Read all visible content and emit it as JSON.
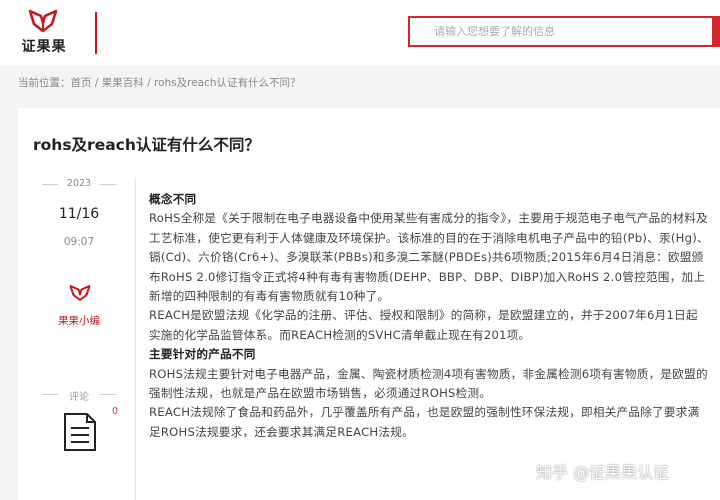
{
  "header": {
    "logo_text": "证果果",
    "search_placeholder": "请输入您想要了解的信息"
  },
  "breadcrumb": {
    "label": "当前位置：",
    "items": [
      "首页",
      "果果百科",
      "rohs及reach认证有什么不同？"
    ],
    "separator": "/"
  },
  "article": {
    "title": "rohs及reach认证有什么不同？",
    "year": "2023",
    "date": "11/16",
    "time": "09:07",
    "author": "果果小编",
    "comment_label": "评论",
    "comment_count": "0",
    "paragraphs": [
      {
        "text": "概念不同",
        "heading": true
      },
      {
        "text": "RoHS全称是《关于限制在电子电器设备中使用某些有害成分的指令》，主要用于规范电子电气产品的材料及工艺标准，使它更有利于人体健康及环境保护。该标准的目的在于消除电机电子产品中的铅(Pb)、汞(Hg)、镉(Cd)、六价铬(Cr6+)、多溴联苯(PBBs)和多溴二苯醚(PBDEs)共6项物质;2015年6月4日消息：欧盟颁布RoHS 2.0修订指令正式将4种有毒有害物质(DEHP、BBP、DBP、DIBP)加入RoHS 2.0管控范围，加上新增的四种限制的有毒有害物质就有10种了。",
        "heading": false
      },
      {
        "text": "REACH是欧盟法规《化学品的注册、评估、授权和限制》的简称，是欧盟建立的，并于2007年6月1日起实施的化学品监管体系。而REACH检测的SVHC清单截止现在有201项。",
        "heading": false
      },
      {
        "text": "主要针对的产品不同",
        "heading": true
      },
      {
        "text": "ROHS法规主要针对电子电器产品，金属、陶瓷材质检测4项有害物质，非金属检测6项有害物质，是欧盟的强制性法规，也就是产品在欧盟市场销售，必须通过ROHS检测。",
        "heading": false
      },
      {
        "text": "REACH法规除了食品和药品外，几乎覆盖所有产品，也是欧盟的强制性环保法规，即相关产品除了要求满足ROHS法规要求，还会要求其满足REACH法规。",
        "heading": false
      }
    ]
  },
  "watermark": "知乎 @证果果认证",
  "colors": {
    "brand_red": "#c8161d",
    "search_border": "#d9262e",
    "page_bg": "#f4f4f4"
  },
  "icons": {
    "logo": "book-logo-icon",
    "author": "book-logo-icon",
    "comment": "comment-document-icon"
  }
}
